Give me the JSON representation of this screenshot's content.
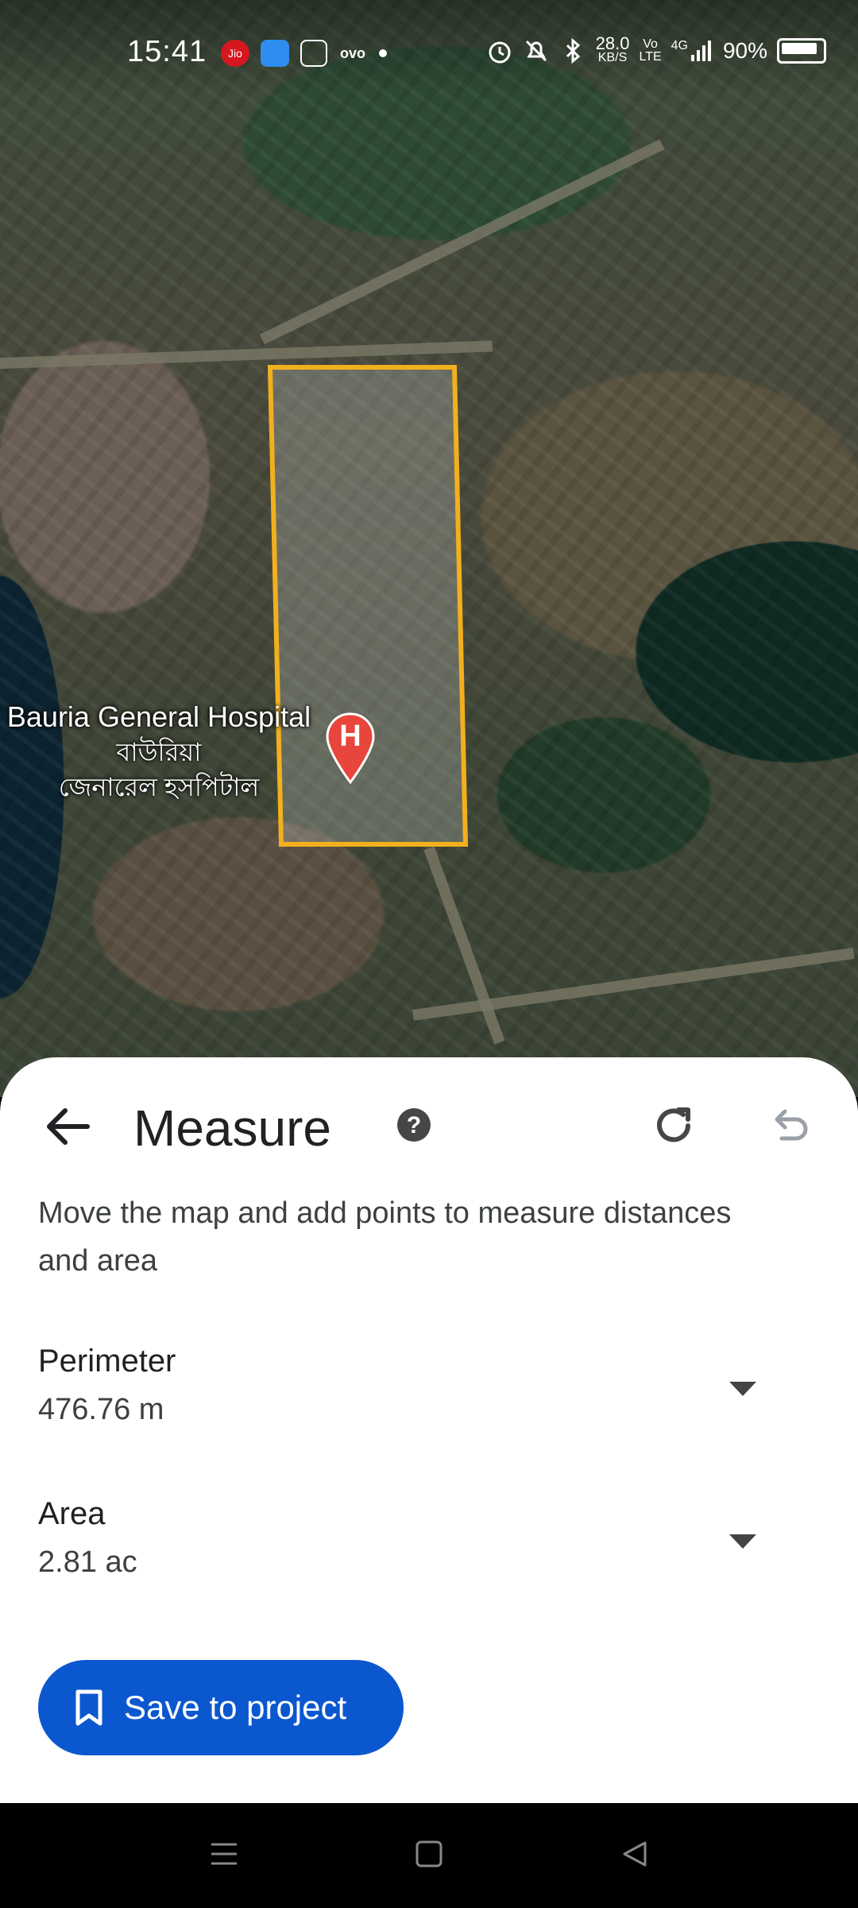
{
  "status_bar": {
    "time": "15:41",
    "net_speed_value": "28.0",
    "net_speed_unit": "KB/S",
    "volte_top": "Vo",
    "volte_bottom": "LTE",
    "network": "4G",
    "battery": "90%",
    "app_icons": [
      "jio-icon",
      "blue-app-icon",
      "calculator-icon",
      "ovo-icon"
    ],
    "jio_label": "Jio",
    "ovo_label": "ovo"
  },
  "map": {
    "place_name": "Bauria General Hospital",
    "place_name_bengali_1": "বাউরিয়া",
    "place_name_bengali_2": "জেনারেল হসপিটাল",
    "marker_letter": "H",
    "polygon_color": "#f2b01e",
    "marker_color": "#e8453c"
  },
  "sheet": {
    "title": "Measure",
    "instructions": "Move the map and add points to measure distances and area",
    "perimeter": {
      "label": "Perimeter",
      "value": "476.76 m"
    },
    "area": {
      "label": "Area",
      "value": "2.81 ac"
    },
    "save_label": "Save to project",
    "save_color": "#0b57d0"
  },
  "nav_bar": {
    "items": [
      "menu-nav-icon",
      "home-nav-icon",
      "back-nav-icon"
    ]
  }
}
